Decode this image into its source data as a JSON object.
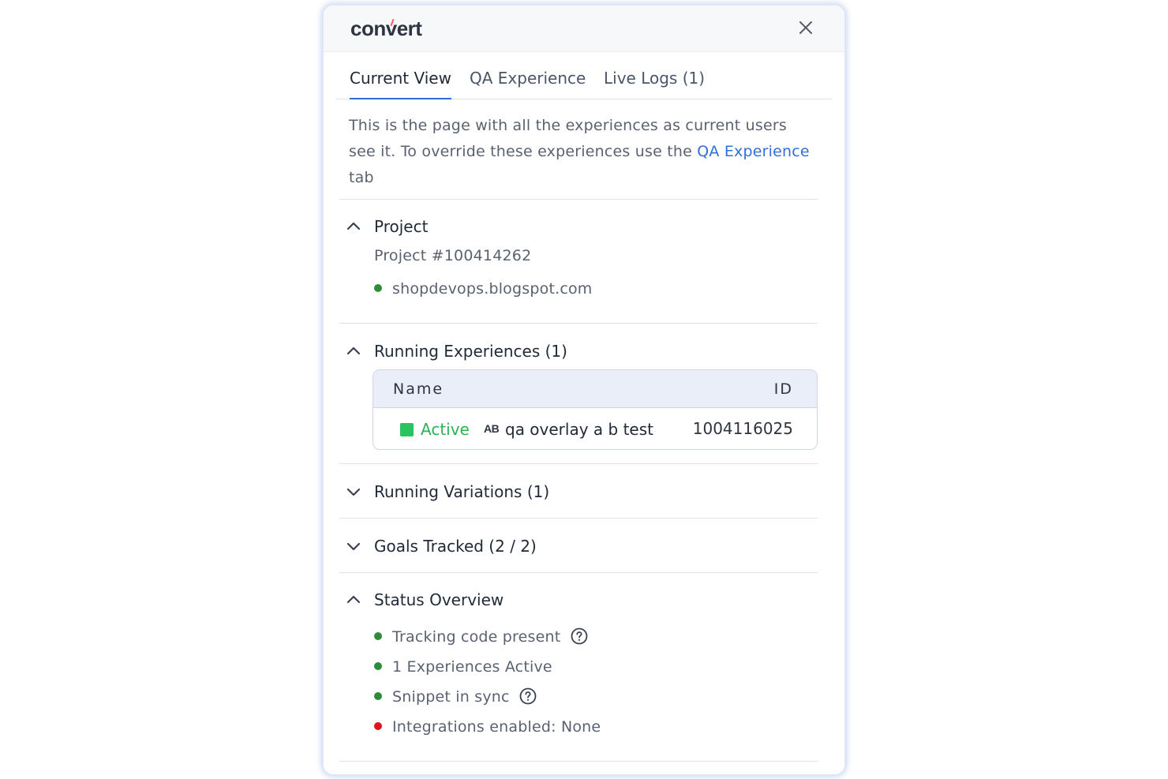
{
  "header": {
    "logo_text": "convert",
    "close_icon": "close-icon"
  },
  "tabs": [
    {
      "label": "Current View",
      "active": true
    },
    {
      "label": "QA Experience",
      "active": false
    },
    {
      "label": "Live Logs (1)",
      "active": false
    }
  ],
  "intro": {
    "text_before": "This is the page with all the experiences as current users see it. To override these experiences use the",
    "link": "QA Experience",
    "text_after": "tab"
  },
  "sections": {
    "project": {
      "title": "Project",
      "expanded": true,
      "project_id": "Project #100414262",
      "domain": "shopdevops.blogspot.com",
      "domain_status_color": "#2e8b3a"
    },
    "running_experiences": {
      "title": "Running Experiences (1)",
      "expanded": true,
      "columns": [
        "Name",
        "ID"
      ],
      "rows": [
        {
          "status": "Active",
          "type_badge": "AB",
          "name": "qa overlay a b test",
          "id": "1004116025"
        }
      ]
    },
    "running_variations": {
      "title": "Running Variations (1)",
      "expanded": false
    },
    "goals_tracked": {
      "title": "Goals Tracked (2 / 2)",
      "expanded": false
    },
    "status_overview": {
      "title": "Status Overview",
      "expanded": true,
      "items": [
        {
          "label": "Tracking code present",
          "status": "ok",
          "has_help": true
        },
        {
          "label": "1 Experiences Active",
          "status": "ok",
          "has_help": false
        },
        {
          "label": "Snippet in sync",
          "status": "ok",
          "has_help": true
        },
        {
          "label": "Integrations enabled: None",
          "status": "error",
          "has_help": false
        }
      ]
    }
  },
  "colors": {
    "accent": "#2f6fdb",
    "ok": "#2e8b3a",
    "error": "#e0141e",
    "active_green": "#28c45d"
  }
}
